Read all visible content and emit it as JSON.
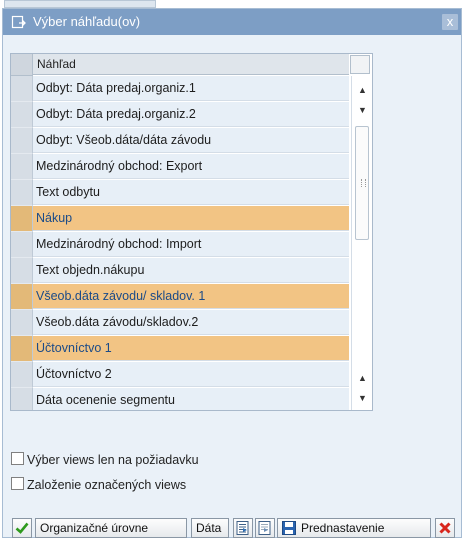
{
  "dialog": {
    "title": "Výber náhľadu(ov)",
    "close_label": "x"
  },
  "table": {
    "column_header": "Náhľad",
    "rows": [
      {
        "label": "Odbyt: Dáta predaj.organiz.1",
        "selected": false
      },
      {
        "label": "Odbyt: Dáta predaj.organiz.2",
        "selected": false
      },
      {
        "label": "Odbyt: Všeob.dáta/dáta závodu",
        "selected": false
      },
      {
        "label": "Medzinárodný obchod: Export",
        "selected": false
      },
      {
        "label": "Text odbytu",
        "selected": false
      },
      {
        "label": "Nákup",
        "selected": true
      },
      {
        "label": "Medzinárodný obchod: Import",
        "selected": false
      },
      {
        "label": "Text objedn.nákupu",
        "selected": false
      },
      {
        "label": "Všeob.dáta závodu/ skladov. 1",
        "selected": true
      },
      {
        "label": "Všeob.dáta závodu/skladov.2",
        "selected": false
      },
      {
        "label": "Účtovníctvo 1",
        "selected": true
      },
      {
        "label": "Účtovníctvo 2",
        "selected": false
      },
      {
        "label": "Dáta ocenenie segmentu",
        "selected": false
      }
    ]
  },
  "options": {
    "views_on_request": {
      "label": "Výber views len na požiadavku",
      "checked": false
    },
    "create_selected_views": {
      "label": "Založenie označených views",
      "checked": false
    }
  },
  "buttons": {
    "confirm_icon": "green-check-icon",
    "org_levels": "Organizačné úrovne",
    "data": "Dáta",
    "select_all_icon": "select-all-icon",
    "deselect_all_icon": "deselect-all-icon",
    "default_values": "Prednastavenie",
    "default_values_icon": "save-disk-icon",
    "cancel_icon": "red-x-icon"
  },
  "colors": {
    "titlebar": "#7d9ec5",
    "selected_row": "#f2c484",
    "selected_text": "#1b4b88"
  }
}
